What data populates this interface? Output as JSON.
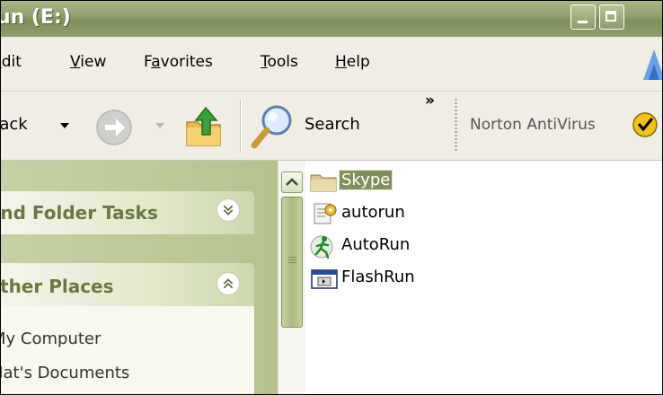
{
  "window": {
    "title": "Run (E:)"
  },
  "menu": {
    "items": [
      {
        "label": "Edit"
      },
      {
        "label": "View"
      },
      {
        "label": "Favorites"
      },
      {
        "label": "Tools"
      },
      {
        "label": "Help"
      }
    ]
  },
  "toolbar": {
    "back_label": "Back",
    "search_label": "Search",
    "more_label": "»",
    "norton_label": "Norton AntiVirus"
  },
  "left_pane": {
    "file_tasks_title": "File and Folder Tasks",
    "other_places_title": "Other Places",
    "places": [
      {
        "label": "My Computer"
      },
      {
        "label": "Mat's Documents"
      }
    ]
  },
  "files": [
    {
      "name": "Skype",
      "icon": "folder-icon",
      "selected": true
    },
    {
      "name": "autorun",
      "icon": "autorun-inf-icon",
      "selected": false
    },
    {
      "name": "AutoRun",
      "icon": "running-man-icon",
      "selected": false
    },
    {
      "name": "FlashRun",
      "icon": "flash-app-icon",
      "selected": false
    }
  ],
  "colors": {
    "selection": "#7f8f5e",
    "pane_heading": "#6b7744"
  }
}
